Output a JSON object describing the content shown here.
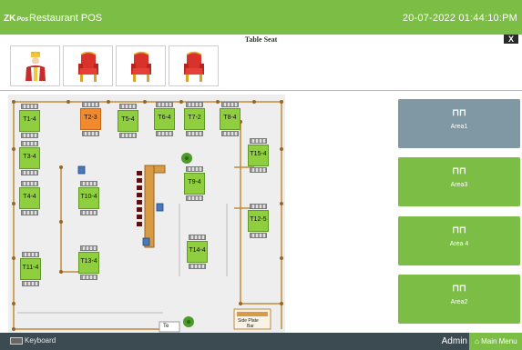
{
  "header": {
    "logo_text": "ZK",
    "logo_suffix": "Pos",
    "app_title": "Restaurant POS",
    "datetime": "20-07-2022 01:44:10:PM"
  },
  "seat_panel": {
    "title": "Table Seat",
    "close_label": "X",
    "seats": [
      {
        "icon": "king-figure-icon"
      },
      {
        "icon": "red-throne-chair-icon"
      },
      {
        "icon": "red-throne-chair-icon"
      },
      {
        "icon": "red-throne-chair-icon"
      }
    ]
  },
  "floor": {
    "tables": [
      {
        "label": "T1-4",
        "status": "free"
      },
      {
        "label": "T2-3",
        "status": "occupied"
      },
      {
        "label": "T5-4",
        "status": "free"
      },
      {
        "label": "T6-4",
        "status": "free"
      },
      {
        "label": "T7-2",
        "status": "free"
      },
      {
        "label": "T8-4",
        "status": "free"
      },
      {
        "label": "T3-4",
        "status": "free"
      },
      {
        "label": "T15-4",
        "status": "free"
      },
      {
        "label": "T4-4",
        "status": "free"
      },
      {
        "label": "T10-4",
        "status": "free"
      },
      {
        "label": "T9-4",
        "status": "free"
      },
      {
        "label": "T12-5",
        "status": "free"
      },
      {
        "label": "T14-4",
        "status": "free"
      },
      {
        "label": "T11-4",
        "status": "free"
      },
      {
        "label": "T13-4",
        "status": "free"
      }
    ],
    "side_plate_label_1": "Side Plate",
    "side_plate_label_2": "Bar",
    "partial_label": "Te"
  },
  "areas": [
    {
      "label": "Area1",
      "color": "#7f98a3"
    },
    {
      "label": "Area3",
      "color": "#7cbd45"
    },
    {
      "label": "Area 4",
      "color": "#7cbd45"
    },
    {
      "label": "Area2",
      "color": "#7cbd45"
    }
  ],
  "footer": {
    "keyboard_label": "Keyboard",
    "user": "Admin",
    "main_menu_label": "Main Menu"
  },
  "colors": {
    "header_green": "#7cbd45",
    "area_selected": "#7f98a3",
    "occupied_table": "#f08a2c",
    "free_table": "#8fcf3f",
    "footer_bg": "#3c4a52"
  }
}
